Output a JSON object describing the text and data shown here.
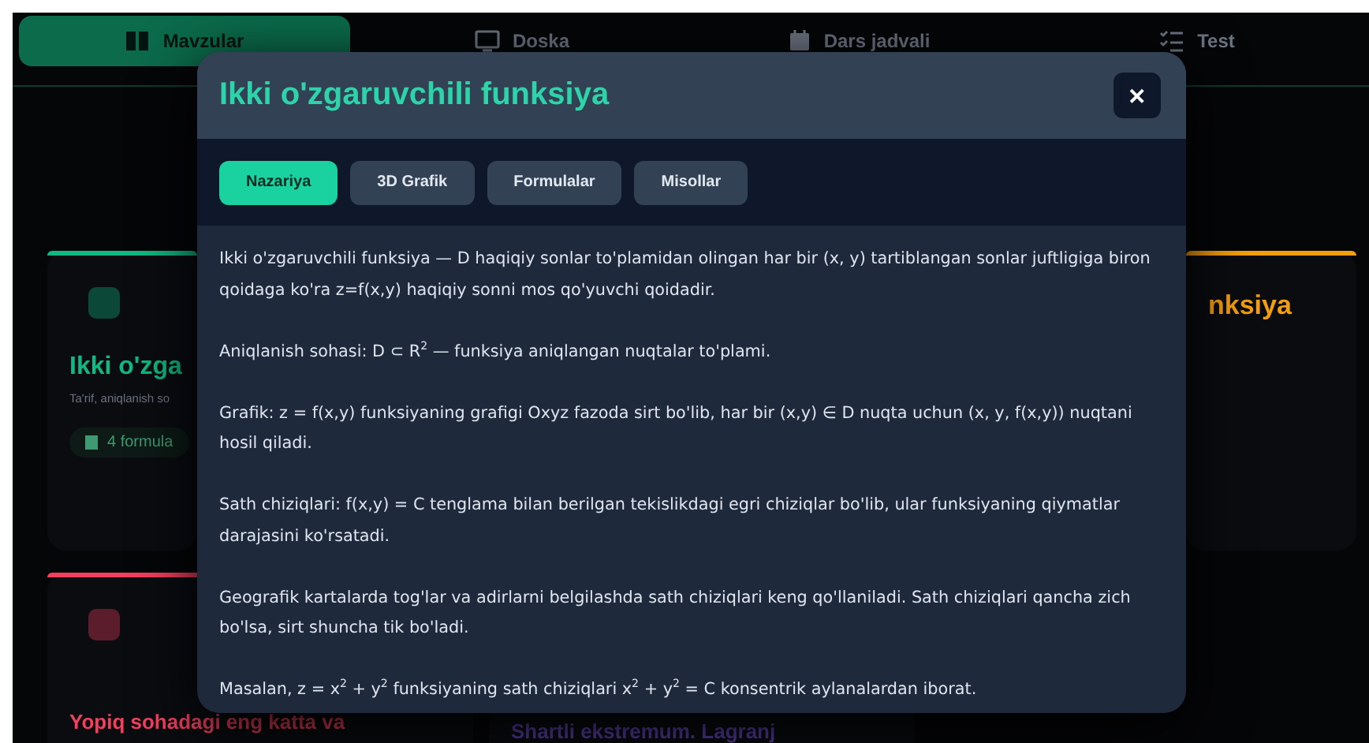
{
  "nav": {
    "tabs": [
      {
        "label": "Mavzular",
        "selected": true
      },
      {
        "label": "Doska",
        "selected": false
      },
      {
        "label": "Dars jadvali",
        "selected": false
      },
      {
        "label": "Test",
        "selected": false
      }
    ]
  },
  "cards": [
    {
      "title": "Ikki o'zga",
      "subtitle": "Ta'rif, aniqlanish so",
      "chip": "4 formula",
      "color": "#10b981"
    },
    {
      "title": "nksiya",
      "color": "#f59e0b"
    },
    {
      "title": "Yopiq sohadagi eng katta va",
      "color": "#f43f5e"
    },
    {
      "title": "Shartli ekstremum. Lagranj"
    }
  ],
  "modal": {
    "title": "Ikki o'zgaruvchili funksiya",
    "close": "✕",
    "tabs": [
      {
        "label": "Nazariya",
        "selected": true
      },
      {
        "label": "3D Grafik",
        "selected": false
      },
      {
        "label": "Formulalar",
        "selected": false
      },
      {
        "label": "Misollar",
        "selected": false
      }
    ],
    "paragraphs": [
      "Ikki o'zgaruvchili funksiya — D haqiqiy sonlar to'plamidan olingan har bir (x, y) tartiblangan sonlar juftligiga biron qoidaga ko'ra z=f(x,y) haqiqiy sonni mos qo'yuvchi qoidadir.",
      "Aniqlanish sohasi: D ⊂ R$^{2}$ — funksiya aniqlangan nuqtalar to'plami.",
      "Grafik: z = f(x,y) funksiyaning grafigi Oxyz fazoda sirt bo'lib, har bir (x,y) ∈ D nuqta uchun (x, y, f(x,y)) nuqtani hosil qiladi.",
      "Sath chiziqlari: f(x,y) = C tenglama bilan berilgan tekislikdagi egri chiziqlar bo'lib, ular funksiyaning qiymatlar darajasini ko'rsatadi.",
      "Geografik kartalarda tog'lar va adirlarni belgilashda sath chiziqlari keng qo'llaniladi. Sath chiziqlari qancha zich bo'lsa, sirt shuncha tik bo'ladi.",
      "Masalan, z = x$^{2}$ + y$^{2}$ funksiyaning sath chiziqlari x$^{2}$ + y$^{2}$ = C konsentrik aylanalardan iborat."
    ]
  }
}
